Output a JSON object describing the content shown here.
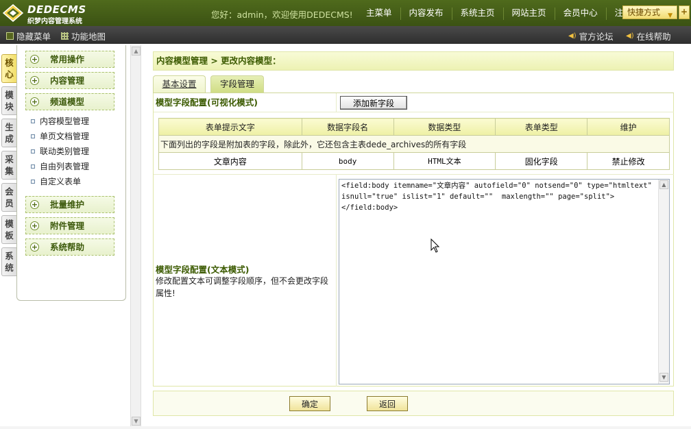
{
  "header": {
    "logo_title": "DEDECMS",
    "logo_sub": "织梦内容管理系统",
    "welcome": "您好：admin，欢迎使用DEDECMS!",
    "nav": [
      "主菜单",
      "内容发布",
      "系统主页",
      "网站主页",
      "会员中心",
      "注销"
    ],
    "quick_label": "快捷方式",
    "plus_label": "+"
  },
  "subbar": {
    "hide_menu": "隐藏菜单",
    "site_map": "功能地图",
    "forum": "官方论坛",
    "help": "在线帮助"
  },
  "vtabs": [
    "核心",
    "模块",
    "生成",
    "采集",
    "会员",
    "模板",
    "系统"
  ],
  "menu": {
    "common": "常用操作",
    "content": "内容管理",
    "channel": "频道模型",
    "channel_links": [
      "内容模型管理",
      "单页文档管理",
      "联动类别管理",
      "自由列表管理",
      "自定义表单"
    ],
    "batch": "批量维护",
    "attach": "附件管理",
    "syshelp": "系统帮助"
  },
  "main": {
    "breadcrumb": "内容模型管理 > 更改内容模型：",
    "tabs": [
      "基本设置",
      "字段管理"
    ],
    "visual_title": "模型字段配置(可视化模式)",
    "add_field_button": "添加新字段",
    "table_headers": [
      "表单提示文字",
      "数据字段名",
      "数据类型",
      "表单类型",
      "维护"
    ],
    "table_note": "下面列出的字段是附加表的字段，除此外，它还包含主表dede_archives的所有字段",
    "table_row": [
      "文章内容",
      "body",
      "HTML文本",
      "固化字段",
      "禁止修改"
    ],
    "text_title": "模型字段配置(文本模式)",
    "text_desc": "修改配置文本可调整字段顺序，但不会更改字段属性!",
    "editor_text": "<field:body itemname=\"文章内容\" autofield=\"0\" notsend=\"0\" type=\"htmltext\" isnull=\"true\" islist=\"1\" default=\"\"  maxlength=\"\" page=\"split\">\n</field:body>",
    "ok_button": "确定",
    "back_button": "返回"
  },
  "colors": {
    "header_green": "#4f6a1c",
    "title_text": "#3b5a00",
    "panel_bg": "#edf2b3"
  }
}
